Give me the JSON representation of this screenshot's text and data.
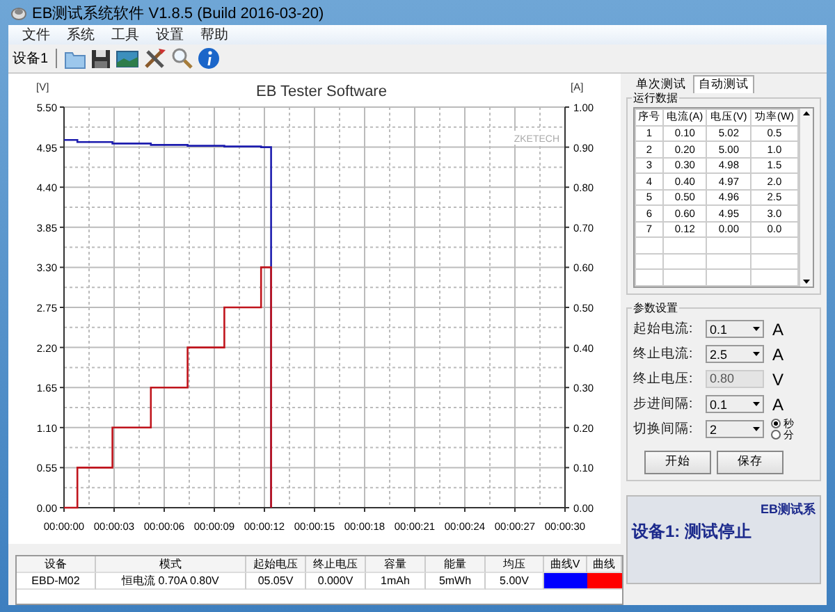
{
  "window": {
    "title": "EB测试系统软件 V1.8.5 (Build 2016-03-20)"
  },
  "menu": [
    "文件",
    "系统",
    "工具",
    "设置",
    "帮助"
  ],
  "toolbar": {
    "device": "设备1"
  },
  "chart": {
    "brand": "ZKETECH",
    "chart_data": {
      "type": "line",
      "title": "EB Tester Software",
      "ylabel": "[V]",
      "y2label": "[A]",
      "x": [
        0,
        0.8,
        0.8,
        2.9,
        2.9,
        5.2,
        5.2,
        7.4,
        7.4,
        9.6,
        9.6,
        11.8,
        11.8,
        12.4,
        12.4
      ],
      "series": [
        {
          "color": "#1c1cae",
          "values": [
            5.05,
            5.05,
            5.02,
            5.02,
            5.0,
            5.0,
            4.98,
            4.98,
            4.97,
            4.97,
            4.96,
            4.96,
            4.95,
            4.95,
            0
          ]
        },
        {
          "color": "#c0141c",
          "axis": "y2",
          "values": [
            0,
            0,
            0.1,
            0.1,
            0.2,
            0.2,
            0.3,
            0.3,
            0.4,
            0.4,
            0.5,
            0.5,
            0.6,
            0.6,
            0
          ]
        }
      ],
      "grid": true,
      "xlim": [
        0,
        30
      ],
      "ylim": [
        0,
        5.5
      ],
      "y2lim": [
        0,
        1
      ],
      "xticks": [
        {
          "value": 0,
          "label": "00:00:00"
        },
        {
          "value": 3,
          "label": "00:00:03"
        },
        {
          "value": 6,
          "label": "00:00:06"
        },
        {
          "value": 9,
          "label": "00:00:09"
        },
        {
          "value": 12,
          "label": "00:00:12"
        },
        {
          "value": 15,
          "label": "00:00:15"
        },
        {
          "value": 18,
          "label": "00:00:18"
        },
        {
          "value": 21,
          "label": "00:00:21"
        },
        {
          "value": 24,
          "label": "00:00:24"
        },
        {
          "value": 27,
          "label": "00:00:27"
        },
        {
          "value": 30,
          "label": "00:00:30"
        }
      ],
      "yticks": [
        {
          "value": 0,
          "label": "0.00"
        },
        {
          "value": 0.55,
          "label": "0.55"
        },
        {
          "value": 1.1,
          "label": "1.10"
        },
        {
          "value": 1.65,
          "label": "1.65"
        },
        {
          "value": 2.2,
          "label": "2.20"
        },
        {
          "value": 2.75,
          "label": "2.75"
        },
        {
          "value": 3.3,
          "label": "3.30"
        },
        {
          "value": 3.85,
          "label": "3.85"
        },
        {
          "value": 4.4,
          "label": "4.40"
        },
        {
          "value": 4.95,
          "label": "4.95"
        },
        {
          "value": 5.5,
          "label": "5.50"
        }
      ],
      "y2ticks": [
        {
          "value": 0,
          "label": "0.00"
        },
        {
          "value": 0.1,
          "label": "0.10"
        },
        {
          "value": 0.2,
          "label": "0.20"
        },
        {
          "value": 0.3,
          "label": "0.30"
        },
        {
          "value": 0.4,
          "label": "0.40"
        },
        {
          "value": 0.5,
          "label": "0.50"
        },
        {
          "value": 0.6,
          "label": "0.60"
        },
        {
          "value": 0.7,
          "label": "0.70"
        },
        {
          "value": 0.8,
          "label": "0.80"
        },
        {
          "value": 0.9,
          "label": "0.90"
        },
        {
          "value": 1,
          "label": "1.00"
        }
      ]
    }
  },
  "tabs": [
    {
      "label": "单次测试",
      "selected": false
    },
    {
      "label": "自动测试",
      "selected": true
    }
  ],
  "run_data": {
    "title": "运行数据",
    "columns": [
      "序号",
      "电流(A)",
      "电压(V)",
      "功率(W)"
    ],
    "rows": [
      [
        "1",
        "0.10",
        "5.02",
        "0.5"
      ],
      [
        "2",
        "0.20",
        "5.00",
        "1.0"
      ],
      [
        "3",
        "0.30",
        "4.98",
        "1.5"
      ],
      [
        "4",
        "0.40",
        "4.97",
        "2.0"
      ],
      [
        "5",
        "0.50",
        "4.96",
        "2.5"
      ],
      [
        "6",
        "0.60",
        "4.95",
        "3.0"
      ],
      [
        "7",
        "0.12",
        "0.00",
        "0.0"
      ]
    ]
  },
  "params": {
    "title": "参数设置",
    "fields": [
      {
        "kind": "dropdown",
        "label": "起始电流:",
        "value": "0.1",
        "unit": "A"
      },
      {
        "kind": "dropdown",
        "label": "终止电流:",
        "value": "2.5",
        "unit": "A"
      },
      {
        "kind": "text",
        "label": "终止电压:",
        "value": "0.80",
        "unit": "V"
      },
      {
        "kind": "dropdown",
        "label": "步进间隔:",
        "value": "0.1",
        "unit": "A"
      },
      {
        "kind": "dropdown",
        "label": "切换间隔:",
        "value": "2",
        "radios": [
          {
            "label": "秒",
            "selected": true
          },
          {
            "label": "分",
            "selected": false
          }
        ]
      }
    ],
    "buttons": [
      "开始",
      "保存"
    ]
  },
  "status": {
    "heading": "EB测试系",
    "message": "设备1: 测试停止"
  },
  "summary": {
    "columns": [
      "设备",
      "模式",
      "起始电压",
      "终止电压",
      "容量",
      "能量",
      "均压",
      "曲线V",
      "曲线"
    ],
    "rows": [
      {
        "cells": [
          "EBD-M02",
          "恒电流 0.70A 0.80V",
          "05.05V",
          "0.000V",
          "1mAh",
          "5mWh",
          "5.00V"
        ],
        "curves": [
          {
            "color": "#0000ff"
          },
          {
            "color": "#ff0000"
          }
        ]
      }
    ]
  }
}
